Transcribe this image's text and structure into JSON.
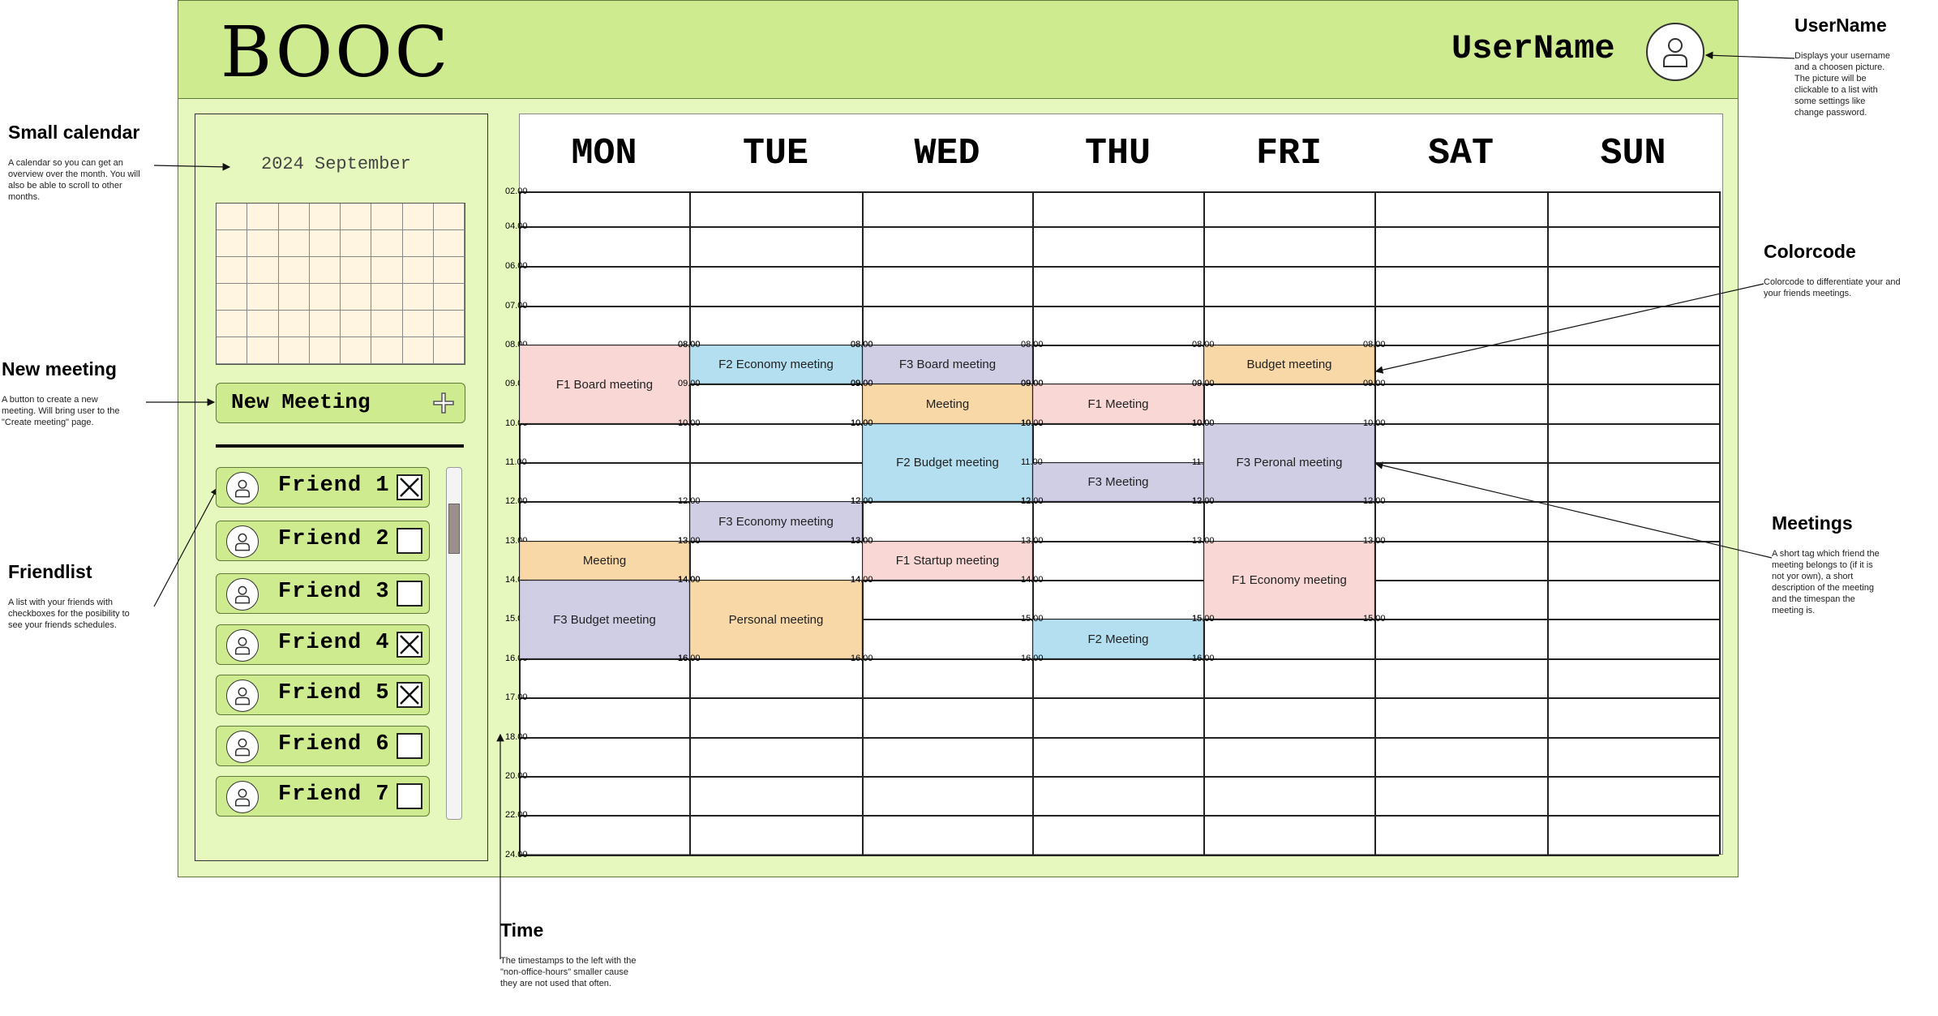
{
  "header": {
    "logo": "BOOC",
    "username": "UserName"
  },
  "sidebar": {
    "month_label": "2024 September",
    "new_meeting_label": "New Meeting",
    "friends": [
      {
        "name": "Friend 1",
        "checked": true
      },
      {
        "name": "Friend 2",
        "checked": false
      },
      {
        "name": "Friend 3",
        "checked": false
      },
      {
        "name": "Friend 4",
        "checked": true
      },
      {
        "name": "Friend 5",
        "checked": true
      },
      {
        "name": "Friend 6",
        "checked": false
      },
      {
        "name": "Friend 7",
        "checked": false
      }
    ]
  },
  "calendar": {
    "days": [
      "MON",
      "TUE",
      "WED",
      "THU",
      "FRI",
      "SAT",
      "SUN"
    ],
    "time_labels": [
      "02.00",
      "04.00",
      "06.00",
      "07.00",
      "08.00",
      "09.00",
      "10.00",
      "11.00",
      "12.00",
      "13.00",
      "14.00",
      "15.00",
      "16.00",
      "17.00",
      "18.00",
      "20.00",
      "22.00",
      "24.00"
    ],
    "events": [
      {
        "day": "MON",
        "title": "F1 Board meeting",
        "start": "08.00",
        "end": "10.00",
        "color": "#f8d7d5"
      },
      {
        "day": "MON",
        "title": "Meeting",
        "start": "13.00",
        "end": "14.00",
        "color": "#f9d8a8"
      },
      {
        "day": "MON",
        "title": "F3 Budget meeting",
        "start": "14.00",
        "end": "16.00",
        "color": "#d0cee5"
      },
      {
        "day": "TUE",
        "title": "F2 Economy meeting",
        "start": "08.00",
        "end": "09.00",
        "color": "#b3dff0"
      },
      {
        "day": "TUE",
        "title": "F3 Economy meeting",
        "start": "12.00",
        "end": "13.00",
        "color": "#d0cee5"
      },
      {
        "day": "TUE",
        "title": "Personal meeting",
        "start": "14.00",
        "end": "16.00",
        "color": "#f9d8a8"
      },
      {
        "day": "WED",
        "title": "F3 Board meeting",
        "start": "08.00",
        "end": "09.00",
        "color": "#d0cee5"
      },
      {
        "day": "WED",
        "title": "Meeting",
        "start": "09.00",
        "end": "10.00",
        "color": "#f9d8a8"
      },
      {
        "day": "WED",
        "title": "F2 Budget meeting",
        "start": "10.00",
        "end": "12.00",
        "color": "#b3dff0"
      },
      {
        "day": "WED",
        "title": "F1 Startup meeting",
        "start": "13.00",
        "end": "14.00",
        "color": "#f8d7d5"
      },
      {
        "day": "THU",
        "title": "F1 Meeting",
        "start": "09.00",
        "end": "10.00",
        "color": "#f8d7d5"
      },
      {
        "day": "THU",
        "title": "F3 Meeting",
        "start": "11.00",
        "end": "12.00",
        "color": "#d0cee5"
      },
      {
        "day": "THU",
        "title": "F2 Meeting",
        "start": "15.00",
        "end": "16.00",
        "color": "#b3dff0"
      },
      {
        "day": "FRI",
        "title": "Budget meeting",
        "start": "08.00",
        "end": "09.00",
        "color": "#f9d8a8"
      },
      {
        "day": "FRI",
        "title": "F3 Peronal meeting",
        "start": "10.00",
        "end": "12.00",
        "color": "#d0cee5"
      },
      {
        "day": "FRI",
        "title": "F1 Economy meeting",
        "start": "13.00",
        "end": "15.00",
        "color": "#f8d7d5"
      }
    ]
  },
  "annotations": [
    {
      "key": "username",
      "title": "UserName",
      "text": "Displays your username and a choosen picture. The picture will be clickable to a list with some settings like change password."
    },
    {
      "key": "small-calendar",
      "title": "Small calendar",
      "text": "A calendar so you can get an overview over the month. You will also be able to scroll to other months."
    },
    {
      "key": "new-meeting",
      "title": "New meeting",
      "text": "A button to create a new meeting. Will bring user to the \"Create meeting\" page."
    },
    {
      "key": "friendlist",
      "title": "Friendlist",
      "text": "A list with your friends with checkboxes for the posibility to see your friends schedules."
    },
    {
      "key": "colorcode",
      "title": "Colorcode",
      "text": "Colorcode to differentiate your and your friends meetings."
    },
    {
      "key": "meetings",
      "title": "Meetings",
      "text": "A short tag which friend the meeting belongs to (if it is not yor own), a short description of the meeting and the timespan the meeting is."
    },
    {
      "key": "time",
      "title": "Time",
      "text": "The timestamps to the left with the \"non-office-hours\" smaller cause they are not used that often."
    }
  ]
}
